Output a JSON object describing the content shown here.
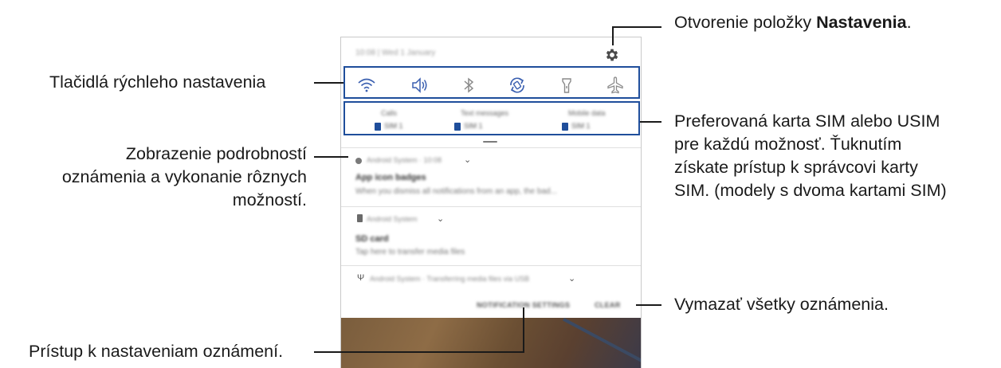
{
  "callouts": {
    "settings_prefix": "Otvorenie položky ",
    "settings_bold": "Nastavenia",
    "settings_suffix": ".",
    "quick_settings": "Tlačidlá rýchleho nastavenia",
    "details_1": "Zobrazenie podrobností",
    "details_2": "oznámenia a vykonanie rôznych",
    "details_3": "možností.",
    "sim_1": "Preferovaná karta SIM alebo USIM",
    "sim_2": "pre každú možnosť. Ťuknutím",
    "sim_3": "získate prístup k správcovi karty",
    "sim_4": "SIM. (modely s dvoma kartami SIM)",
    "clear": "Vymazať všetky oznámenia.",
    "notif_settings": "Prístup k nastaveniam oznámení."
  },
  "phone": {
    "status_text": "10:08 | Wed 1 January",
    "quick_settings": [
      {
        "icon": "wifi-icon"
      },
      {
        "icon": "sound-icon"
      },
      {
        "icon": "bluetooth-icon"
      },
      {
        "icon": "auto-rotate-icon"
      },
      {
        "icon": "flashlight-icon"
      },
      {
        "icon": "airplane-mode-icon"
      }
    ],
    "sim_options": [
      {
        "label": "Calls",
        "sim": "SIM 1"
      },
      {
        "label": "Text messages",
        "sim": "SIM 1"
      },
      {
        "label": "Mobile data",
        "sim": "SIM 1"
      }
    ],
    "notifications": [
      {
        "app": "Android System · 10:08",
        "title": "App icon badges",
        "body": "When you dismiss all notifications from an app, the bad..."
      },
      {
        "app": "Android System",
        "title": "SD card",
        "body": "Tap here to transfer media files"
      },
      {
        "app": "Android System · Transferring media files via USB",
        "title": "",
        "body": ""
      }
    ],
    "actions": {
      "settings": "NOTIFICATION SETTINGS",
      "clear": "CLEAR"
    }
  },
  "colors": {
    "accent": "#1f4e9b",
    "icon": "#3a5fb0"
  }
}
